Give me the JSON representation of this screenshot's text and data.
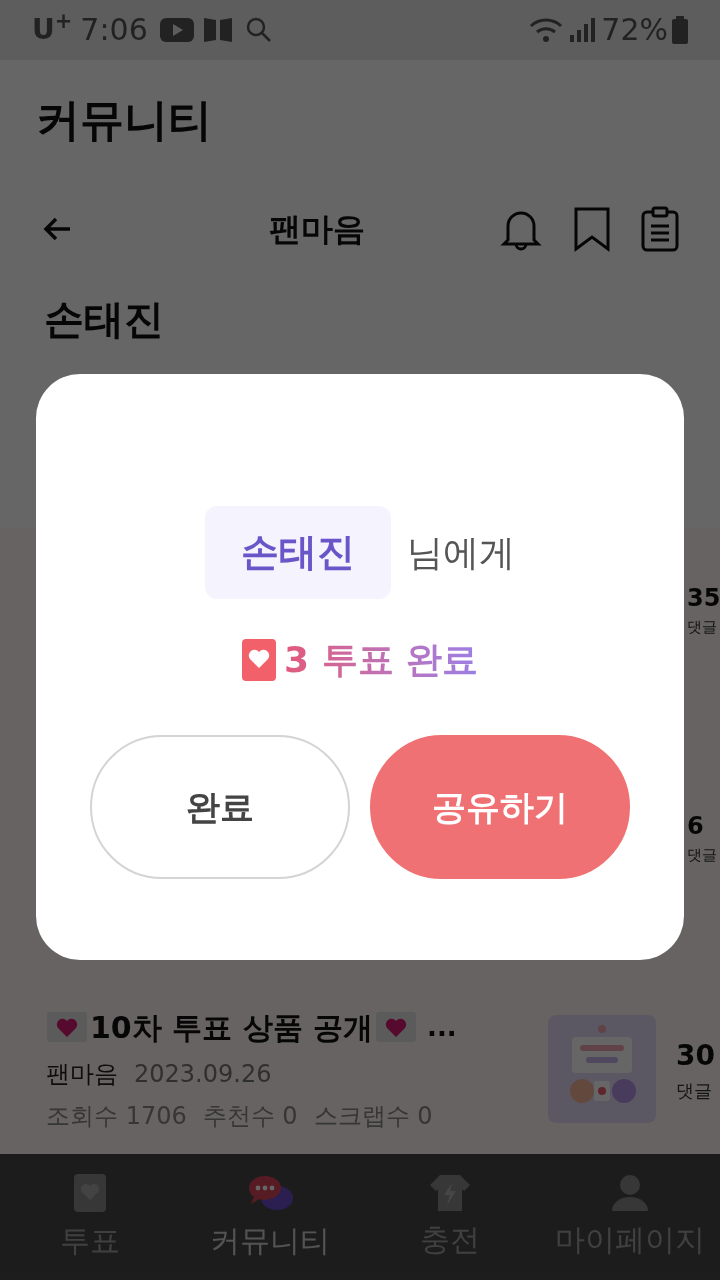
{
  "status_bar": {
    "carrier": "U$^{+}$",
    "time": "7:06",
    "battery": "72%"
  },
  "header": {
    "title": "커뮤니티"
  },
  "toolbar": {
    "title": "팬마음"
  },
  "section_title": "손태진",
  "posts": [
    {
      "comments": "35",
      "comments_label": "댓글"
    },
    {
      "comments": "6",
      "comments_label": "댓글"
    },
    {
      "title": "10차 투표 상품 공개",
      "ellipsis": "...",
      "author": "팬마음",
      "date": "2023.09.26",
      "stats": [
        "조회수 1706",
        "추천수 0",
        "스크랩수 0"
      ],
      "comments": "30",
      "comments_label": "댓글",
      "thumbnail": {
        "kind": "picture"
      }
    }
  ],
  "bottom_nav": [
    {
      "label": "투표",
      "kind": "vote",
      "selected": false
    },
    {
      "label": "커뮤니티",
      "kind": "community",
      "selected": true
    },
    {
      "label": "충전",
      "kind": "charge",
      "selected": false
    },
    {
      "label": "마이페이지",
      "kind": "mypage",
      "selected": false
    }
  ],
  "dialog": {
    "recipient": "손태진",
    "recipient_suffix": "님에게",
    "result": "3 투표 완료",
    "buttons": [
      {
        "label": "완료",
        "kind": "secondary"
      },
      {
        "label": "공유하기",
        "kind": "primary"
      }
    ]
  }
}
